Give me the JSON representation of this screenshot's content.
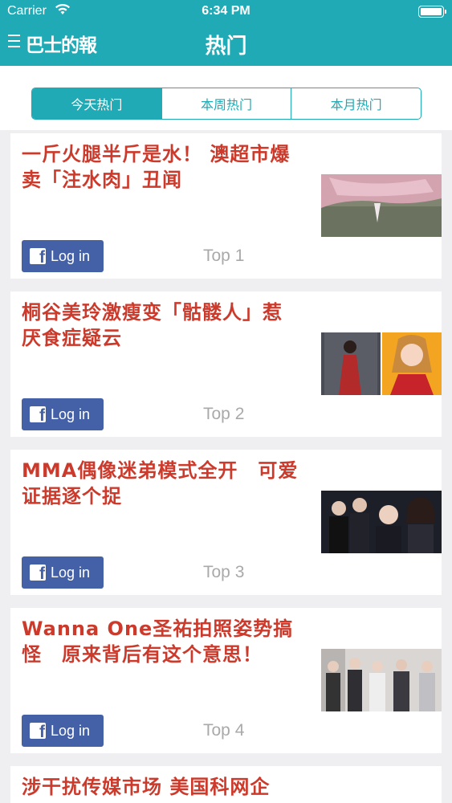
{
  "status_bar": {
    "carrier": "Carrier",
    "time": "6:34 PM"
  },
  "nav": {
    "logo": "巴士的報",
    "title": "热门",
    "menu_icon": "menu-icon"
  },
  "tabs": [
    {
      "label": "今天热门",
      "active": true
    },
    {
      "label": "本周热门",
      "active": false
    },
    {
      "label": "本月热门",
      "active": false
    }
  ],
  "articles": [
    {
      "headline": "一斤火腿半斤是水！ 澳超市爆卖「注水肉」丑闻",
      "login_label": "Log in",
      "rank": "Top 1",
      "thumb": "pink meat on board"
    },
    {
      "headline": "桐谷美玲激瘦变「骷髅人」惹厌食症疑云",
      "login_label": "Log in",
      "rank": "Top 2",
      "thumb": "actress in red dress"
    },
    {
      "headline": "MMA偶像迷弟模式全开　可爱证据逐个捉",
      "login_label": "Log in",
      "rank": "Top 3",
      "thumb": "idols at awards show"
    },
    {
      "headline": "Wanna One圣祐拍照姿势搞怪　原来背后有这个意思！",
      "login_label": "Log in",
      "rank": "Top 4",
      "thumb": "group photo collage"
    },
    {
      "headline": "涉干扰传媒市场 美国科网企",
      "login_label": "",
      "rank": "",
      "thumb": ""
    }
  ],
  "colors": {
    "brand": "#1faab5",
    "headline": "#cc3a2c",
    "facebook": "#4460a6"
  }
}
